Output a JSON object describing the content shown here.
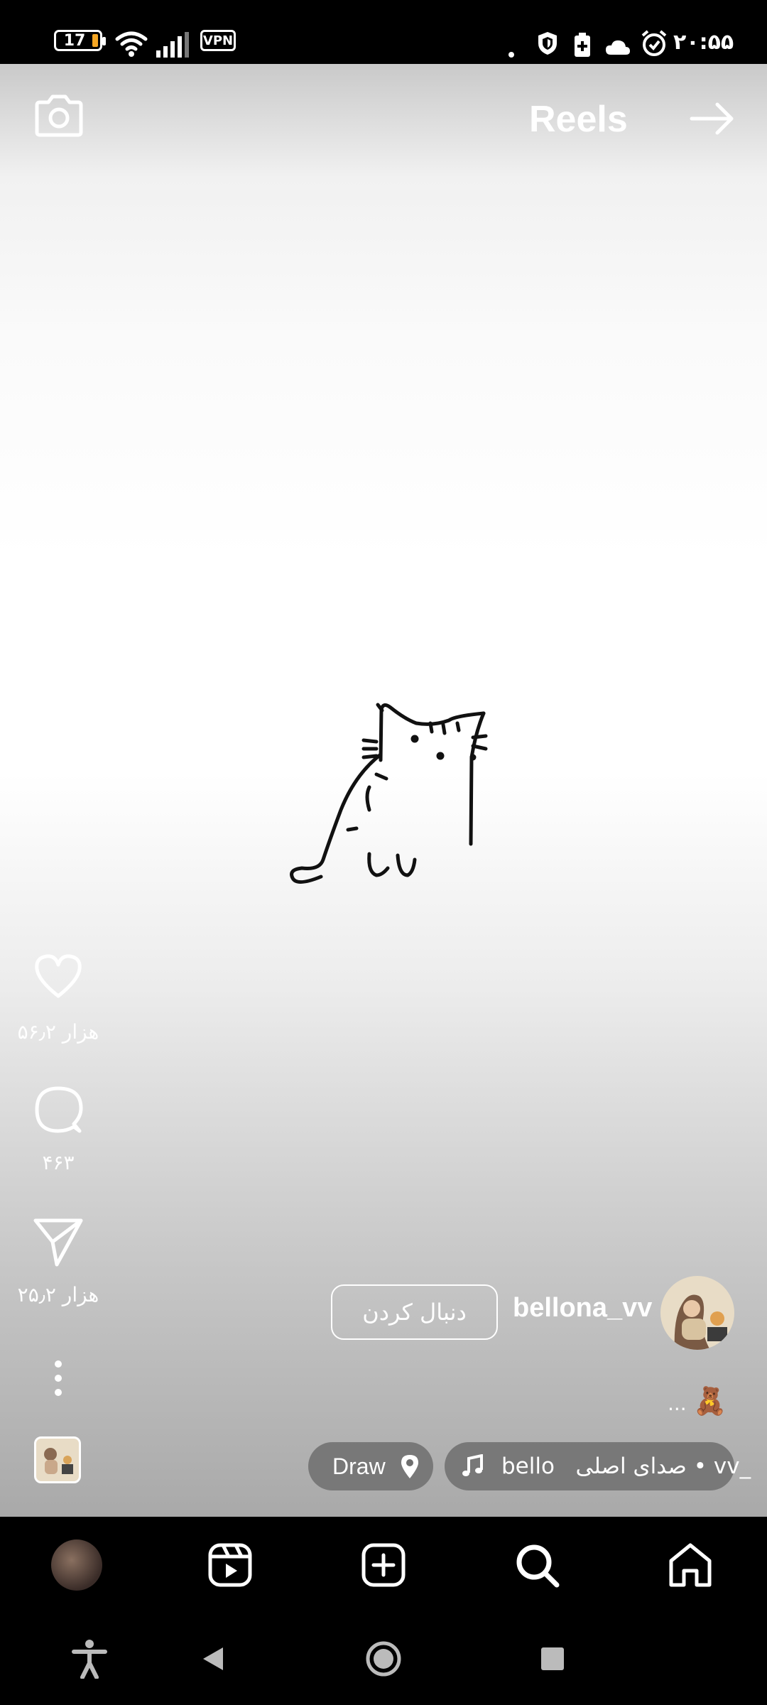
{
  "status_bar": {
    "battery": "17",
    "vpn": "VPN",
    "time": "۲۰:۵۵",
    "icons": [
      "battery-icon",
      "wifi-icon",
      "signal-icon",
      "vpn-icon",
      "dot-icon",
      "shield-icon",
      "battery-saver-icon",
      "cloud-icon",
      "alarm-icon"
    ]
  },
  "header": {
    "title": "Reels",
    "camera_icon": "camera-icon",
    "forward_icon": "arrow-right-icon"
  },
  "actions": {
    "likes": "۵۶٫۲ هزار",
    "comments": "۴۶۳",
    "shares": "۲۵٫۲ هزار"
  },
  "post": {
    "username": "bellona_vv",
    "follow_label": "دنبال کردن",
    "caption_emoji": "🧸",
    "caption_more": "...",
    "audio_text": "bello   صدای اصلی • vv_",
    "location_text": "Draw"
  },
  "colors": {
    "background": "#000000",
    "accent_battery": "#f5a623",
    "pill": "#6e6e6e"
  }
}
